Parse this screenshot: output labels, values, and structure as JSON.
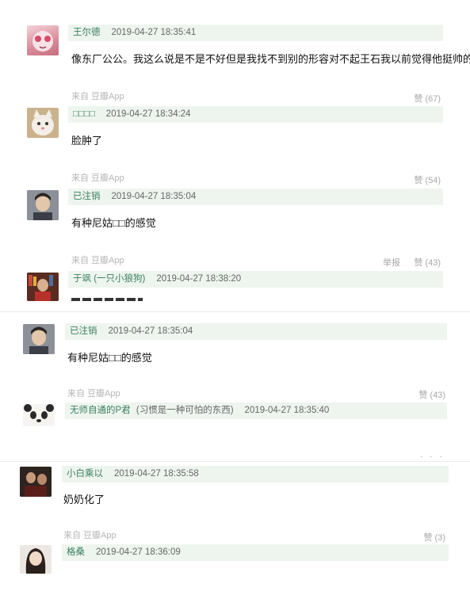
{
  "comments": [
    {
      "author": "王尔德",
      "time": "2019-04-27 18:35:41",
      "text": "像东厂公公。我这么说是不是不好但是我找不到别的形容对不起王石我以前觉得他挺帅的",
      "source": "来自 豆瓣App",
      "votes": "赞 (67)",
      "avatar": "pink-cat-avatar"
    },
    {
      "author": "□□□□",
      "time": "2019-04-27 18:34:24",
      "text": "脸肿了",
      "source": "来自 豆瓣App",
      "votes": "赞 (54)",
      "avatar": "white-cat-avatar"
    },
    {
      "author": "已注销",
      "time": "2019-04-27 18:35:04",
      "text": "有种尼姑□□的感觉",
      "source": "来自 豆瓣App",
      "report": "举报",
      "votes": "赞 (43)",
      "avatar": "young-man-avatar"
    },
    {
      "author": "于飒 (一只小狼狗)",
      "time": "2019-04-27 18:38:20",
      "text": "",
      "avatar": "bookshelf-avatar"
    },
    {
      "author": "已注销",
      "time": "2019-04-27 18:35:04",
      "text": "有种尼姑□□的感觉",
      "source": "来自 豆瓣App",
      "votes": "赞 (43)",
      "avatar": "young-man-avatar"
    },
    {
      "author": "无师自通的P君",
      "author_note": "(习惯是一种可怕的东西)",
      "time": "2019-04-27 18:35:40",
      "text": "",
      "avatar": "panda-avatar"
    },
    {
      "author": "小白乘以",
      "time": "2019-04-27 18:35:58",
      "text": "奶奶化了",
      "source": "来自 豆瓣App",
      "votes": "赞 (3)",
      "avatar": "dark-photo-avatar"
    },
    {
      "author": "格桑",
      "time": "2019-04-27 18:36:09",
      "text": "",
      "avatar": "girl-avatar"
    }
  ],
  "colors": {
    "header_bg": "#eef5ef",
    "author": "#3a7f5e",
    "meta": "#b5b5b5"
  }
}
